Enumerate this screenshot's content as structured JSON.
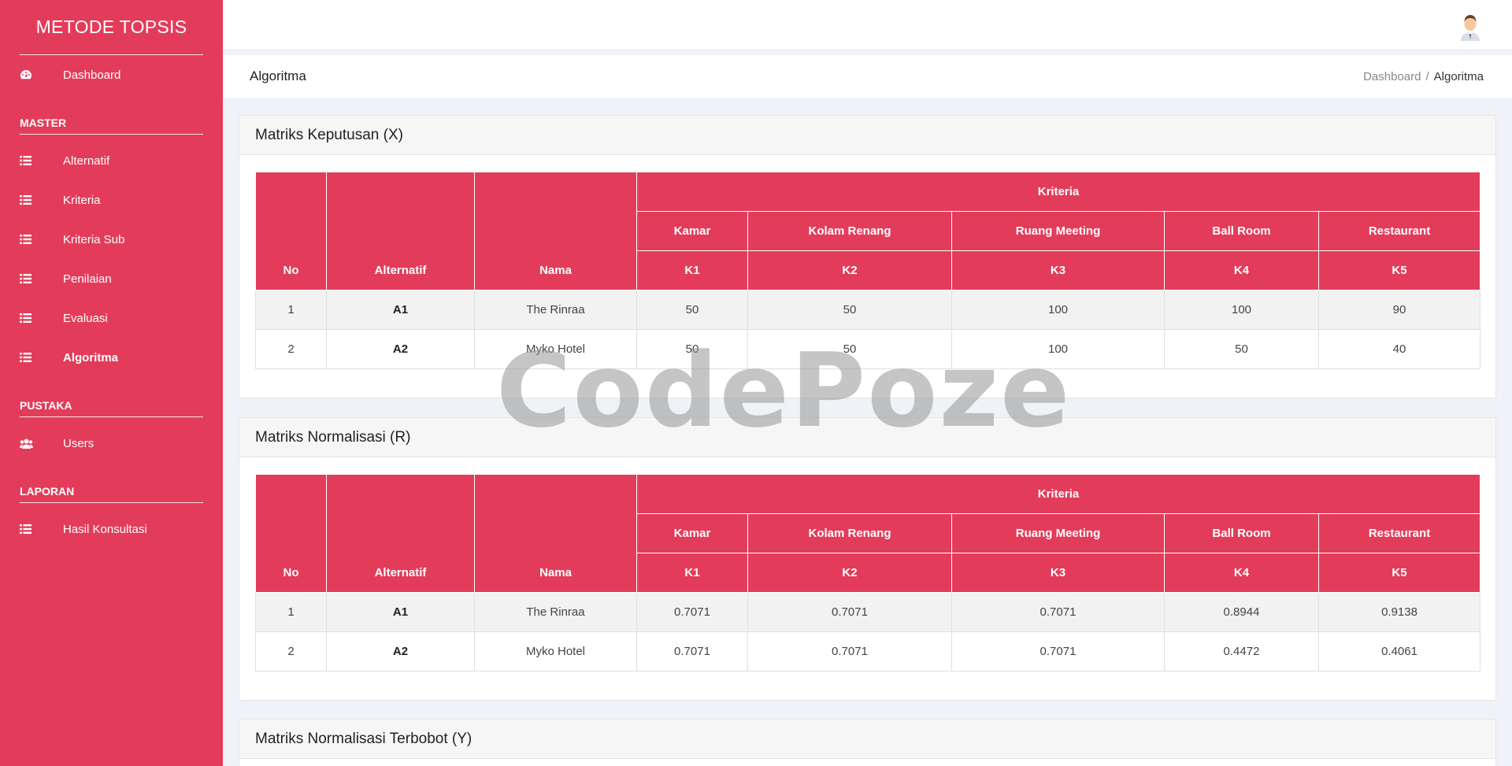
{
  "sidebar": {
    "brand": "METODE TOPSIS",
    "dashboard": "Dashboard",
    "sections": [
      {
        "title": "MASTER",
        "items": [
          "Alternatif",
          "Kriteria",
          "Kriteria Sub",
          "Penilaian",
          "Evaluasi",
          "Algoritma"
        ]
      },
      {
        "title": "PUSTAKA",
        "items": [
          "Users"
        ]
      },
      {
        "title": "LAPORAN",
        "items": [
          "Hasil Konsultasi"
        ]
      }
    ]
  },
  "page": {
    "title": "Algoritma",
    "breadcrumb": {
      "home": "Dashboard",
      "sep": "/",
      "current": "Algoritma"
    }
  },
  "table_headers": {
    "no": "No",
    "alternatif": "Alternatif",
    "nama": "Nama",
    "kriteria": "Kriteria",
    "criteria_names": [
      "Kamar",
      "Kolam Renang",
      "Ruang Meeting",
      "Ball Room",
      "Restaurant"
    ],
    "criteria_codes": [
      "K1",
      "K2",
      "K3",
      "K4",
      "K5"
    ]
  },
  "cards": [
    {
      "title": "Matriks Keputusan (X)",
      "rows": [
        {
          "no": "1",
          "alt": "A1",
          "nama": "The Rinraa",
          "vals": [
            "50",
            "50",
            "100",
            "100",
            "90"
          ]
        },
        {
          "no": "2",
          "alt": "A2",
          "nama": "Myko Hotel",
          "vals": [
            "50",
            "50",
            "100",
            "50",
            "40"
          ]
        }
      ]
    },
    {
      "title": "Matriks Normalisasi (R)",
      "rows": [
        {
          "no": "1",
          "alt": "A1",
          "nama": "The Rinraa",
          "vals": [
            "0.7071",
            "0.7071",
            "0.7071",
            "0.8944",
            "0.9138"
          ]
        },
        {
          "no": "2",
          "alt": "A2",
          "nama": "Myko Hotel",
          "vals": [
            "0.7071",
            "0.7071",
            "0.7071",
            "0.4472",
            "0.4061"
          ]
        }
      ]
    },
    {
      "title": "Matriks Normalisasi Terbobot (Y)"
    }
  ],
  "watermark": "CodePoze",
  "colors": {
    "accent": "#e33c5a",
    "background": "#f0f2f7"
  }
}
